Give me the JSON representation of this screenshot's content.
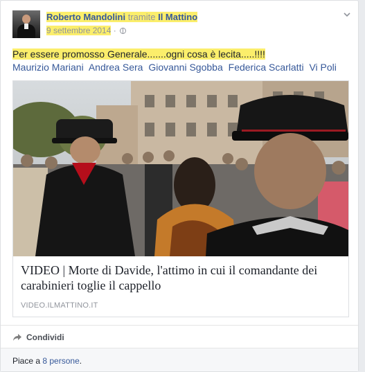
{
  "post": {
    "author": "Roberto Mandolini",
    "via_text": "tramite",
    "page_name": "Il Mattino",
    "date": "9 settembre 2014",
    "separator": "·",
    "message": "Per essere promosso Generale.......ogni cosa è lecita.....!!!!",
    "tags": [
      "Maurizio Mariani",
      "Andrea Sera",
      "Giovanni Sgobba",
      "Federica Scarlatti",
      "Vi Poli"
    ],
    "audience_icon": "globe-icon",
    "menu_icon": "chevron-down-icon"
  },
  "link_preview": {
    "title": "VIDEO | Morte di Davide, l'attimo in cui il comandante dei carabinieri toglie il cappello",
    "domain": "VIDEO.ILMATTINO.IT"
  },
  "actions": {
    "share_label": "Condividi",
    "share_icon": "share-arrow-icon"
  },
  "likes": {
    "prefix": "Piace a",
    "count_link": "8 persone",
    "suffix": "."
  },
  "colors": {
    "link": "#365899",
    "highlight": "#fbee6b",
    "meta": "#90949c"
  }
}
